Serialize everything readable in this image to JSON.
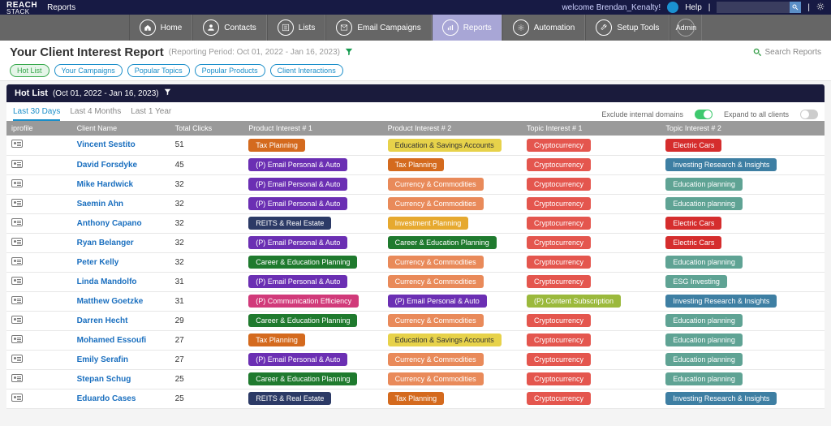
{
  "topbar": {
    "logo_line1": "REACH",
    "logo_line2": "STACK",
    "app_section": "Reports",
    "welcome": "welcome Brendan_Kenalty!",
    "help": "Help"
  },
  "nav": [
    {
      "icon": "home",
      "label": "Home"
    },
    {
      "icon": "user",
      "label": "Contacts"
    },
    {
      "icon": "list",
      "label": "Lists"
    },
    {
      "icon": "mail",
      "label": "Email Campaigns"
    },
    {
      "icon": "chart",
      "label": "Reports",
      "active": true
    },
    {
      "icon": "gear",
      "label": "Automation"
    },
    {
      "icon": "wrench",
      "label": "Setup Tools"
    },
    {
      "icon": "",
      "label": "Admin",
      "admin": true
    }
  ],
  "report": {
    "title": "Your Client Interest Report",
    "period": "(Reporting Period: Oct 01, 2022 - Jan 16, 2023)",
    "search_placeholder": "Search Reports"
  },
  "filters": [
    {
      "label": "Hot List",
      "active": true
    },
    {
      "label": "Your Campaigns"
    },
    {
      "label": "Popular Topics"
    },
    {
      "label": "Popular Products"
    },
    {
      "label": "Client Interactions"
    }
  ],
  "section": {
    "title": "Hot List",
    "range": "(Oct 01, 2022 - Jan 16, 2023)"
  },
  "range_tabs": [
    {
      "label": "Last 30 Days",
      "active": true
    },
    {
      "label": "Last 4 Months"
    },
    {
      "label": "Last 1 Year"
    }
  ],
  "toggles": {
    "exclude_label": "Exclude internal domains",
    "exclude_on": true,
    "expand_label": "Expand to all clients",
    "expand_on": false
  },
  "columns": [
    "iprofile",
    "Client Name",
    "Total Clicks",
    "Product Interest # 1",
    "Product Interest # 2",
    "Topic Interest # 1",
    "Topic Interest # 2"
  ],
  "tag_colors": {
    "Tax Planning": "#d46a1e",
    "(P) Email Personal & Auto": "#6b2fb3",
    "REITS & Real Estate": "#2c3a66",
    "Career & Education Planning": "#1f7a2e",
    "(P) Communication Efficiency": "#d13a7a",
    "Education & Savings Accounts": "#e7d24a",
    "Currency & Commodities": "#e98a5a",
    "Investment Planning": "#e6a92f",
    "Cryptocurrency": "#e4564e",
    "(P) Content Subscription": "#9bb93c",
    "Electric Cars": "#d52d2d",
    "Investing Research & Insights": "#3e7fa3",
    "Education planning": "#5fa394",
    "ESG Investing": "#5fa394"
  },
  "dark_text_tags": [
    "Education & Savings Accounts"
  ],
  "rows": [
    {
      "name": "Vincent Sestito",
      "clicks": 51,
      "p1": "Tax Planning",
      "p2": "Education & Savings Accounts",
      "t1": "Cryptocurrency",
      "t2": "Electric Cars"
    },
    {
      "name": "David Forsdyke",
      "clicks": 45,
      "p1": "(P) Email Personal & Auto",
      "p2": "Tax Planning",
      "t1": "Cryptocurrency",
      "t2": "Investing Research & Insights"
    },
    {
      "name": "Mike Hardwick",
      "clicks": 32,
      "p1": "(P) Email Personal & Auto",
      "p2": "Currency & Commodities",
      "t1": "Cryptocurrency",
      "t2": "Education planning"
    },
    {
      "name": "Saemin Ahn",
      "clicks": 32,
      "p1": "(P) Email Personal & Auto",
      "p2": "Currency & Commodities",
      "t1": "Cryptocurrency",
      "t2": "Education planning"
    },
    {
      "name": "Anthony Capano",
      "clicks": 32,
      "p1": "REITS & Real Estate",
      "p2": "Investment Planning",
      "t1": "Cryptocurrency",
      "t2": "Electric Cars"
    },
    {
      "name": "Ryan Belanger",
      "clicks": 32,
      "p1": "(P) Email Personal & Auto",
      "p2": "Career & Education Planning",
      "t1": "Cryptocurrency",
      "t2": "Electric Cars"
    },
    {
      "name": "Peter Kelly",
      "clicks": 32,
      "p1": "Career & Education Planning",
      "p2": "Currency & Commodities",
      "t1": "Cryptocurrency",
      "t2": "Education planning"
    },
    {
      "name": "Linda Mandolfo",
      "clicks": 31,
      "p1": "(P) Email Personal & Auto",
      "p2": "Currency & Commodities",
      "t1": "Cryptocurrency",
      "t2": "ESG Investing"
    },
    {
      "name": "Matthew Goetzke",
      "clicks": 31,
      "p1": "(P) Communication Efficiency",
      "p2": "(P) Email Personal & Auto",
      "t1": "(P) Content Subscription",
      "t2": "Investing Research & Insights"
    },
    {
      "name": "Darren Hecht",
      "clicks": 29,
      "p1": "Career & Education Planning",
      "p2": "Currency & Commodities",
      "t1": "Cryptocurrency",
      "t2": "Education planning"
    },
    {
      "name": "Mohamed Essoufi",
      "clicks": 27,
      "p1": "Tax Planning",
      "p2": "Education & Savings Accounts",
      "t1": "Cryptocurrency",
      "t2": "Education planning"
    },
    {
      "name": "Emily Serafin",
      "clicks": 27,
      "p1": "(P) Email Personal & Auto",
      "p2": "Currency & Commodities",
      "t1": "Cryptocurrency",
      "t2": "Education planning"
    },
    {
      "name": "Stepan Schug",
      "clicks": 25,
      "p1": "Career & Education Planning",
      "p2": "Currency & Commodities",
      "t1": "Cryptocurrency",
      "t2": "Education planning"
    },
    {
      "name": "Eduardo Cases",
      "clicks": 25,
      "p1": "REITS & Real Estate",
      "p2": "Tax Planning",
      "t1": "Cryptocurrency",
      "t2": "Investing Research & Insights"
    }
  ]
}
